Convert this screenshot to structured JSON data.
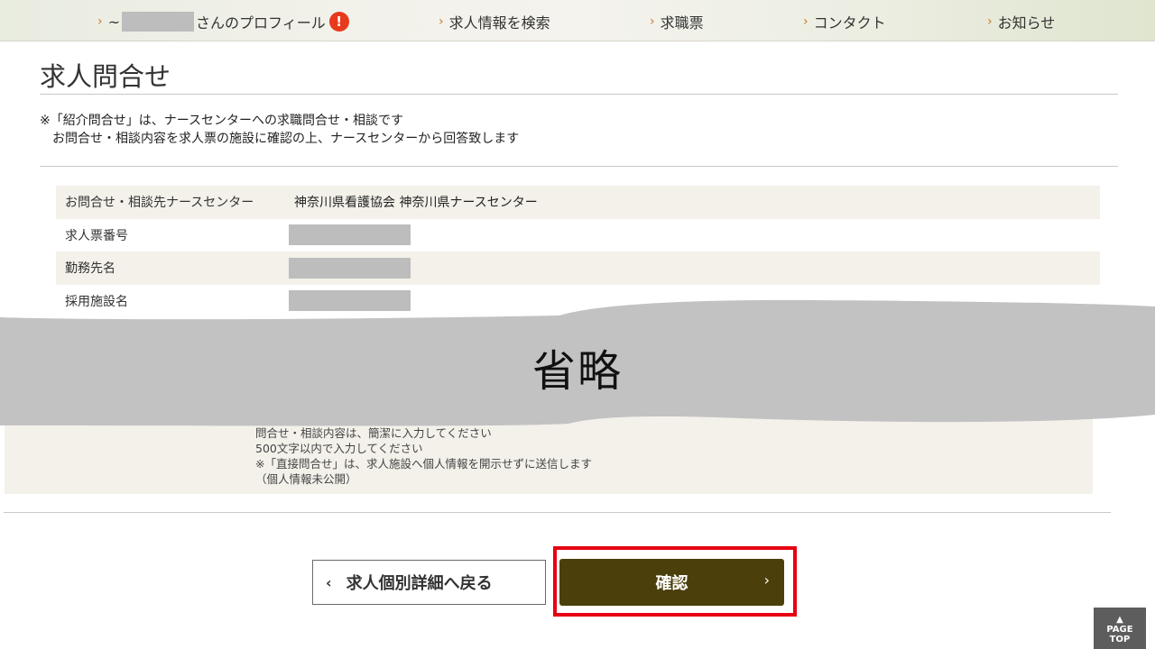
{
  "nav": {
    "profile_suffix": "さんのプロフィール",
    "profile_prefix_char": "~",
    "alert_mark": "!",
    "items": [
      {
        "label": "求人情報を検索"
      },
      {
        "label": "求職票"
      },
      {
        "label": "コンタクト"
      },
      {
        "label": "お知らせ"
      }
    ],
    "chevron": "›"
  },
  "page_title": "求人問合せ",
  "notice": {
    "line1": "※「紹介問合せ」は、ナースセンターへの求職問合せ・相談です",
    "line2": "お問合せ・相談内容を求人票の施設に確認の上、ナースセンターから回答致します"
  },
  "info_rows": [
    {
      "label": "お問合せ・相談先ナースセンター",
      "value": "神奈川県看護協会 神奈川県ナースセンター"
    },
    {
      "label": "求人票番号",
      "value": ""
    },
    {
      "label": "勤務先名",
      "value": ""
    },
    {
      "label": "採用施設名",
      "value": ""
    }
  ],
  "omitted_label": "省略",
  "bottom_notes": {
    "line1": "問合せ・相談内容は、簡潔に入力してください",
    "line2": "500文字以内で入力してください",
    "line3": "※「直接問合せ」は、求人施設へ個人情報を開示せずに送信します",
    "line4": "（個人情報未公開）"
  },
  "buttons": {
    "back_label": "求人個別詳細へ戻る",
    "back_chevron": "‹",
    "confirm_label": "確認",
    "confirm_chevron": "›"
  },
  "pagetop": {
    "arrow": "▲",
    "line1": "PAGE",
    "line2": "TOP"
  },
  "colors": {
    "confirm_bg": "#4b3f0c",
    "highlight": "#e60012",
    "alert": "#e8391c",
    "accent_chevron": "#c8792a"
  }
}
